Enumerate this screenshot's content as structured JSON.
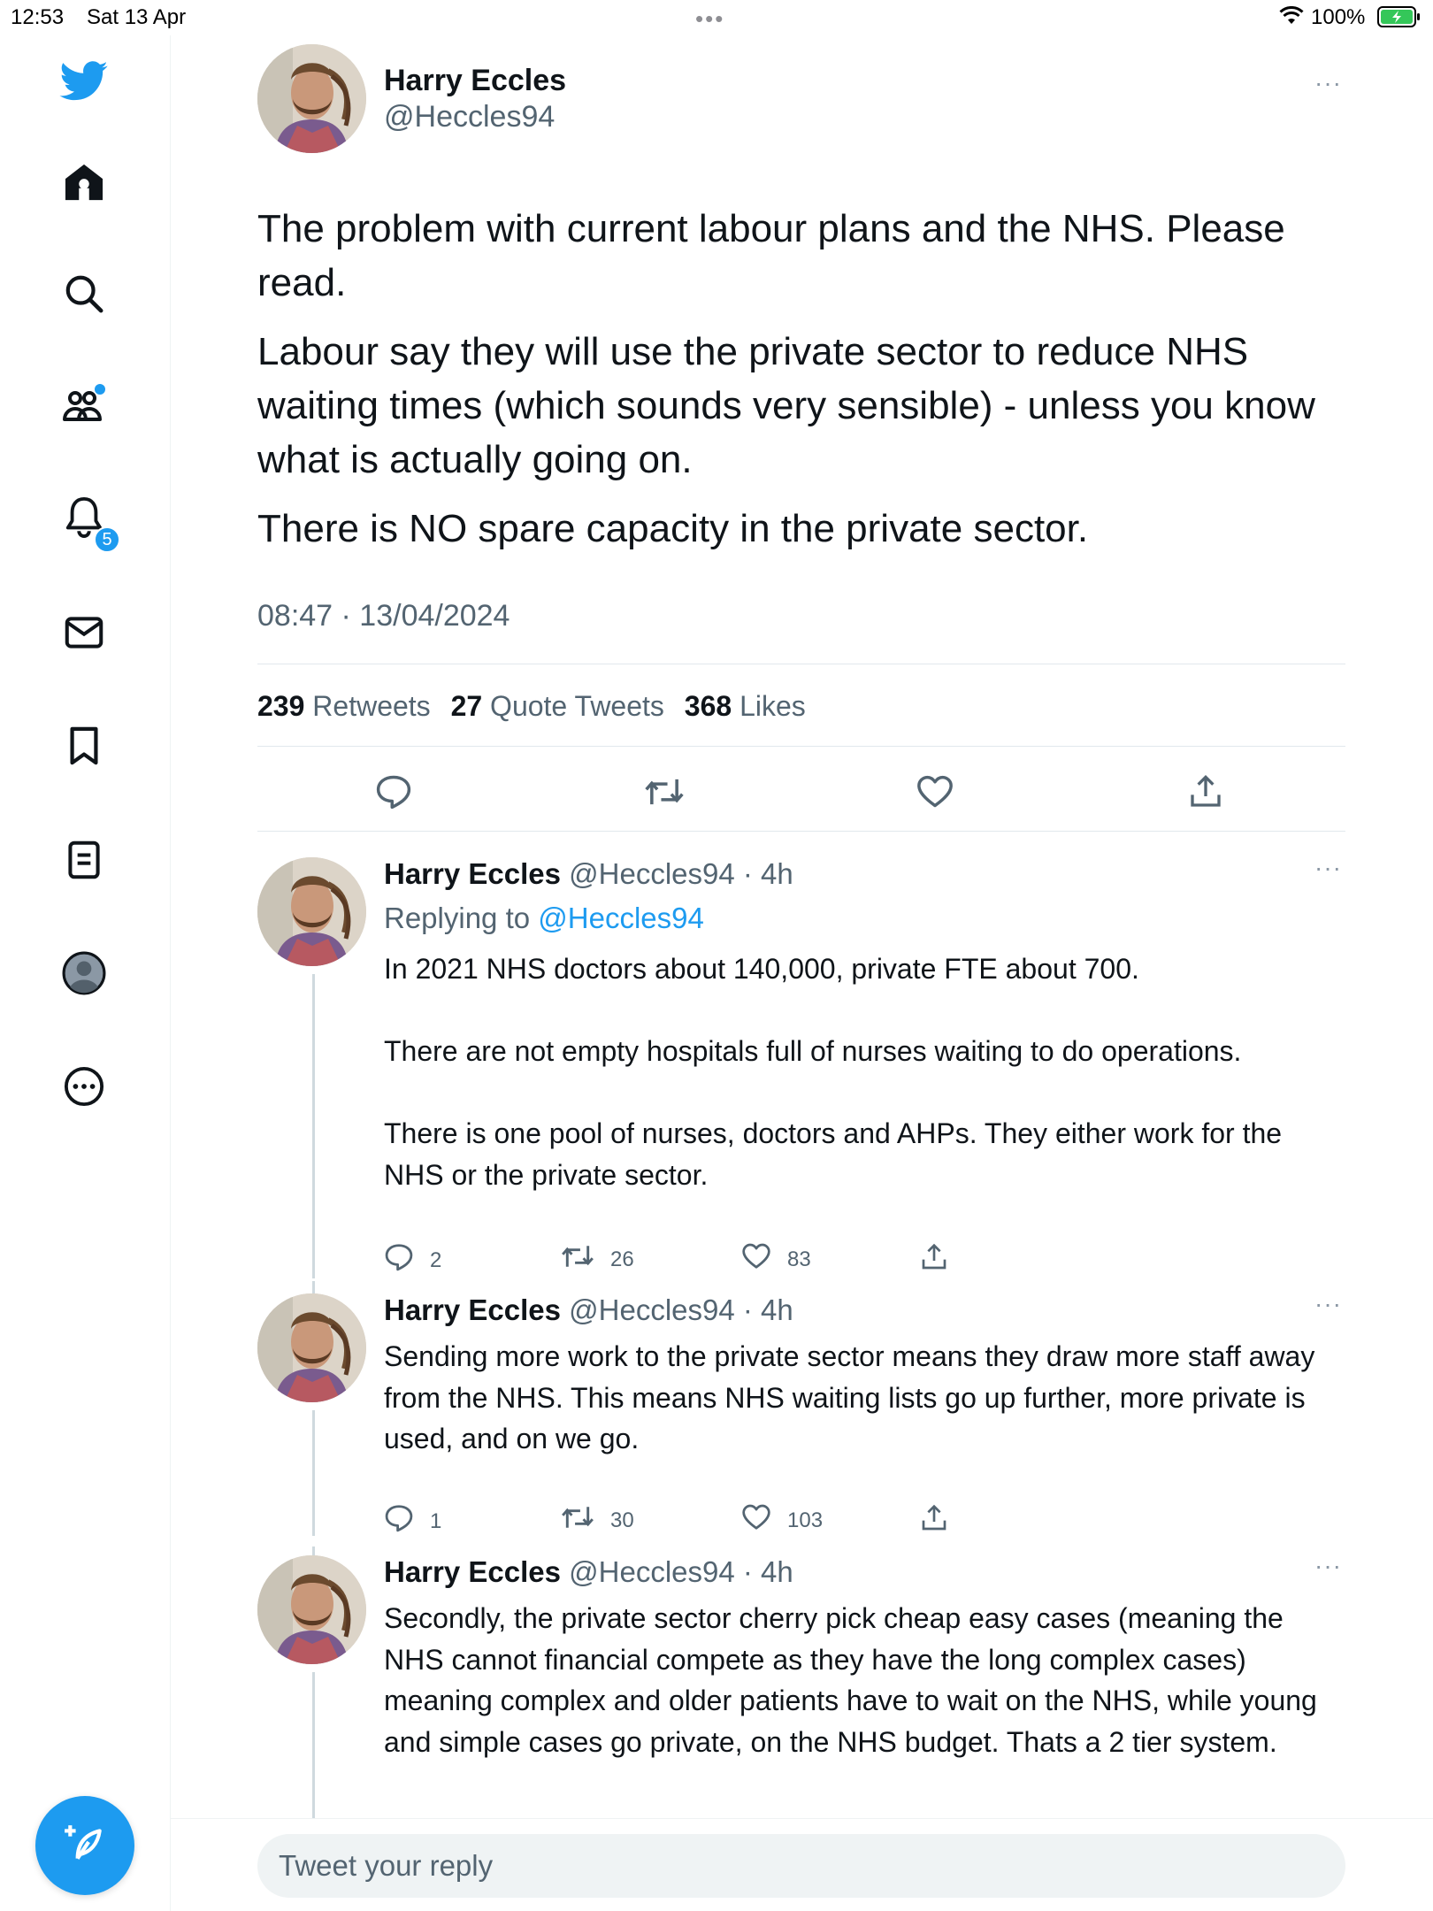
{
  "status_bar": {
    "time": "12:53",
    "date": "Sat 13 Apr",
    "battery": "100%"
  },
  "colors": {
    "accent": "#1d9bf0",
    "text_primary": "#0f1419",
    "text_secondary": "#536471"
  },
  "sidebar": {
    "items": [
      {
        "icon": "twitter-logo-icon"
      },
      {
        "icon": "home-icon"
      },
      {
        "icon": "search-icon"
      },
      {
        "icon": "communities-icon"
      },
      {
        "icon": "notifications-icon",
        "badge": "5"
      },
      {
        "icon": "messages-icon"
      },
      {
        "icon": "bookmarks-icon"
      },
      {
        "icon": "lists-icon"
      },
      {
        "icon": "profile-icon"
      },
      {
        "icon": "more-icon"
      }
    ],
    "compose_icon": "compose-tweet-icon"
  },
  "tweet": {
    "name": "Harry Eccles",
    "handle": "@Heccles94",
    "paragraphs": [
      "The problem with current labour plans and the NHS. Please read.",
      "Labour say they will use the private sector to reduce NHS waiting times (which sounds very sensible) - unless you know what is actually going on.",
      "There is NO spare capacity in the private sector."
    ],
    "timestamp": "08:47 · 13/04/2024",
    "stats": {
      "retweets": "239",
      "retweets_label": "Retweets",
      "quotes": "27",
      "quotes_label": "Quote Tweets",
      "likes": "368",
      "likes_label": "Likes"
    }
  },
  "replies": [
    {
      "name": "Harry Eccles",
      "handle": "@Heccles94 · 4h",
      "replying_prefix": "Replying to ",
      "replying_to": "@Heccles94",
      "text": "In 2021 NHS doctors about 140,000, private FTE about 700.\n\nThere are not empty hospitals full of nurses waiting to do operations.\n\nThere is one pool of nurses, doctors and AHPs. They either work for the NHS or the private sector.",
      "replies": "2",
      "retweets": "26",
      "likes": "83"
    },
    {
      "name": "Harry Eccles",
      "handle": "@Heccles94 · 4h",
      "text": "Sending more work to the private sector means they draw more staff away from the NHS. This means NHS waiting lists go up further, more private is used, and on we go.",
      "replies": "1",
      "retweets": "30",
      "likes": "103"
    },
    {
      "name": "Harry Eccles",
      "handle": "@Heccles94 · 4h",
      "text": "Secondly, the private sector cherry pick cheap easy cases (meaning the NHS cannot financial compete as they have the long complex cases) meaning  complex and older patients have to wait on the NHS, while young and simple cases go private, on the NHS budget. Thats a 2 tier system."
    }
  ],
  "reply_box": {
    "placeholder": "Tweet your reply"
  }
}
